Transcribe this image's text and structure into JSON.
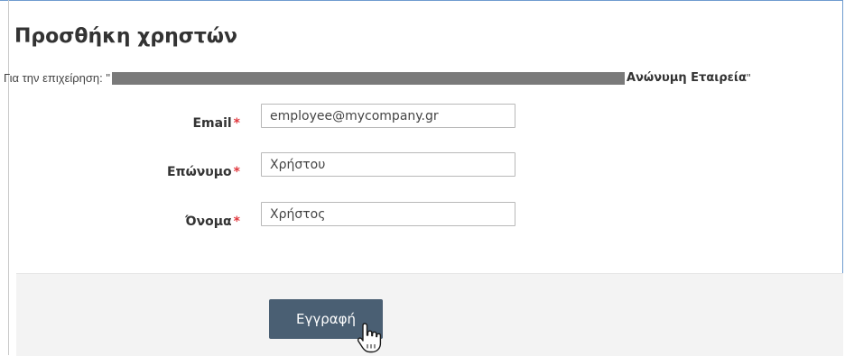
{
  "page": {
    "title": "Προσθήκη χρηστών"
  },
  "company": {
    "prefix": "Για την επιχείρηση: \"",
    "suffix": "Ανώνυμη Εταιρεία",
    "closing_quote": "\""
  },
  "form": {
    "required_mark": "*",
    "email": {
      "label": "Email",
      "value": "employee@mycompany.gr"
    },
    "surname": {
      "label": "Επώνυμο",
      "value": "Χρήστου"
    },
    "first_name": {
      "label": "Όνομα",
      "value": "Χρήστος"
    }
  },
  "actions": {
    "submit_label": "Εγγραφή"
  },
  "colors": {
    "required": "#e0383e",
    "button": "#4a5f73",
    "frame": "#6f9ccf"
  },
  "icons": {
    "cursor": "hand-pointer-icon"
  }
}
